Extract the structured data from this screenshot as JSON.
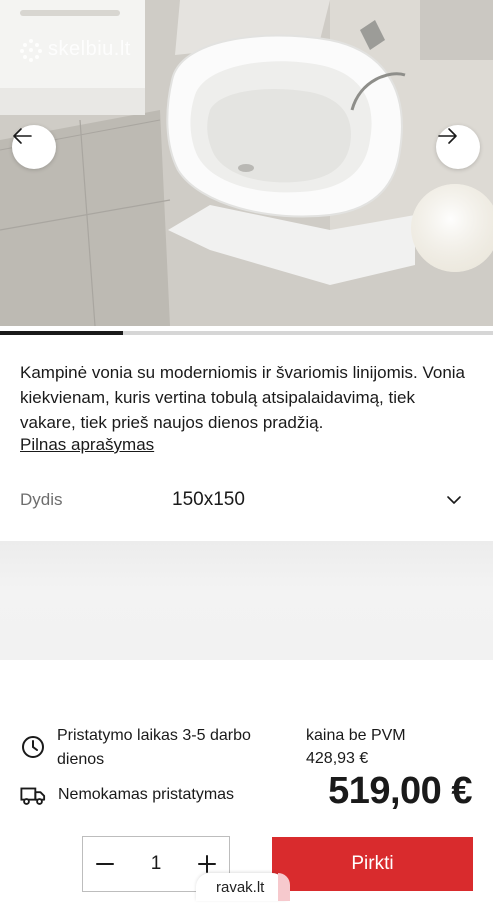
{
  "gallery": {
    "watermark": "skelbiu.lt",
    "prev_icon": "arrow-left-icon",
    "next_icon": "arrow-right-icon",
    "progress": 0.25
  },
  "description": {
    "text": "Kampinė vonia su moderniomis ir švariomis linijomis. Vonia kiekvienam, kuris vertina tobulą atsipalaidavimą, tiek vakare, tiek prieš naujos dienos pradžią.",
    "full_link": "Pilnas aprašymas"
  },
  "size": {
    "label": "Dydis",
    "value": "150x150",
    "icon": "chevron-down-icon"
  },
  "delivery": {
    "time_text": "Pristatymo laikas 3-5 darbo dienos",
    "time_icon": "clock-icon",
    "shipping_text": "Nemokamas pristatymas",
    "shipping_icon": "truck-icon"
  },
  "price": {
    "without_vat_label": "kaina be PVM",
    "without_vat_value": "428,93 €",
    "main": "519,00 €"
  },
  "cart": {
    "quantity": "1",
    "minus_icon": "minus-icon",
    "plus_icon": "plus-icon",
    "buy_label": "Pirkti",
    "accent": "#d92b2d"
  },
  "badge": {
    "text": "ravak.lt"
  }
}
